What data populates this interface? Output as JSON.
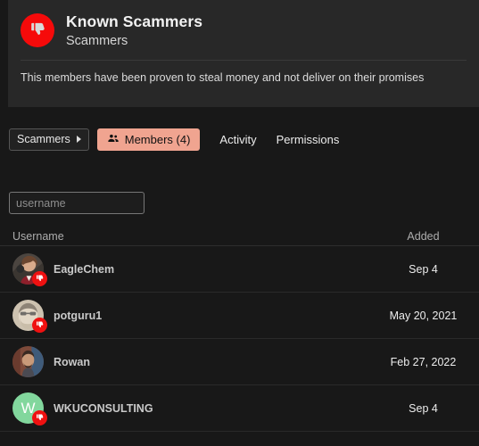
{
  "header": {
    "logo_icon": "thumbs-down-icon",
    "title": "Known Scammers",
    "subtitle": "Scammers",
    "description": "This members have been proven to steal money and not deliver on their promises",
    "logo_bg": "#f60a0a"
  },
  "tabs": {
    "breadcrumb_label": "Scammers",
    "breadcrumb_caret_icon": "caret-right-icon",
    "members_icon": "people-group-icon",
    "members_label": "Members (4)",
    "activity_label": "Activity",
    "permissions_label": "Permissions",
    "active_color": "#f0a490"
  },
  "search": {
    "placeholder": "username",
    "value": ""
  },
  "table": {
    "columns": [
      "Username",
      "Added"
    ],
    "rows": [
      {
        "username": "EagleChem",
        "added": "Sep 4",
        "avatar_type": "photo",
        "avatar_kind": "woman-photo",
        "badge_icon": "thumbs-down-icon",
        "has_badge": true
      },
      {
        "username": "potguru1",
        "added": "May 20, 2021",
        "avatar_type": "photo",
        "avatar_kind": "bearded-man-photo",
        "badge_icon": "thumbs-down-icon",
        "has_badge": true
      },
      {
        "username": "Rowan",
        "added": "Feb 27, 2022",
        "avatar_type": "photo",
        "avatar_kind": "man-photo",
        "badge_icon": "",
        "has_badge": false
      },
      {
        "username": "WKUCONSULTING",
        "added": "Sep 4",
        "avatar_type": "initial",
        "avatar_initial": "W",
        "avatar_bg": "#82d79d",
        "badge_icon": "thumbs-down-icon",
        "has_badge": true
      }
    ]
  }
}
